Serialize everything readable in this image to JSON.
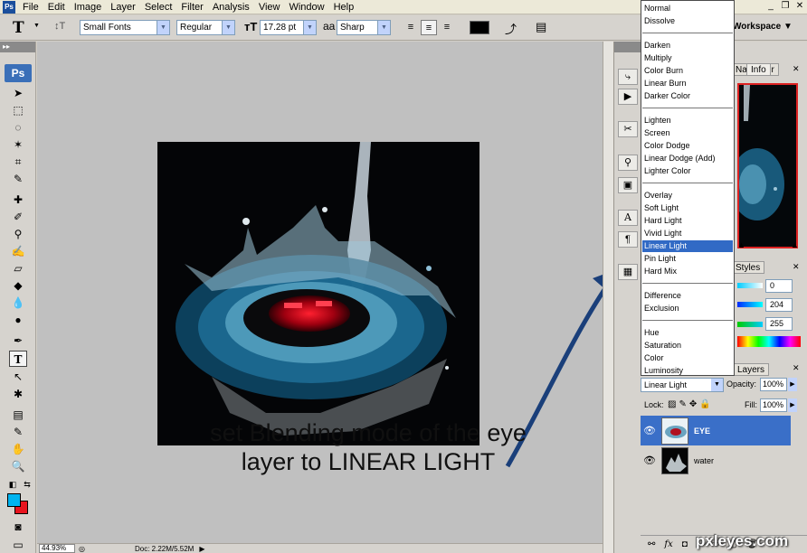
{
  "app": {
    "logo_text": "Ps"
  },
  "menubar": {
    "items": [
      "File",
      "Edit",
      "Image",
      "Layer",
      "Select",
      "Filter",
      "Analysis",
      "View",
      "Window",
      "Help"
    ],
    "workspace_label": "Workspace ▼"
  },
  "options_bar": {
    "tool_glyph": "T",
    "font_family": "Small Fonts",
    "font_style": "Regular",
    "font_size": "17.28 pt",
    "antialias_glyph": "aa",
    "antialias": "Sharp",
    "text_color": "#000000"
  },
  "status_bar": {
    "zoom": "44.93%",
    "doc_info": "Doc: 2.22M/5.52M"
  },
  "panels": {
    "tabs_top": [
      "Navigator",
      "Info"
    ],
    "tab_styles": "Styles",
    "color_values": [
      "0",
      "204",
      "255"
    ],
    "layers_tab": "Layers"
  },
  "layers": {
    "blend_mode": "Linear Light",
    "opacity_label": "Opacity:",
    "opacity": "100%",
    "lock_label": "Lock:",
    "fill_label": "Fill:",
    "fill": "100%",
    "items": [
      {
        "name": "EYE",
        "selected": true
      },
      {
        "name": "water",
        "selected": false
      }
    ],
    "footer_icons": [
      "link-icon",
      "fx-icon",
      "mask-icon",
      "adjustment-icon",
      "folder-icon",
      "new-layer-icon",
      "trash-icon"
    ]
  },
  "blend_modes": {
    "groups": [
      [
        "Normal",
        "Dissolve"
      ],
      [
        "Darken",
        "Multiply",
        "Color Burn",
        "Linear Burn",
        "Darker Color"
      ],
      [
        "Lighten",
        "Screen",
        "Color Dodge",
        "Linear Dodge (Add)",
        "Lighter Color"
      ],
      [
        "Overlay",
        "Soft Light",
        "Hard Light",
        "Vivid Light",
        "Linear Light",
        "Pin Light",
        "Hard Mix"
      ],
      [
        "Difference",
        "Exclusion"
      ],
      [
        "Hue",
        "Saturation",
        "Color",
        "Luminosity"
      ]
    ],
    "selected": "Linear Light"
  },
  "colors": {
    "foreground": "#00b4f0",
    "background": "#e8141e",
    "selection": "#316ac5",
    "arrow": "#1a3f7a"
  },
  "annotation": {
    "line1": "set Blending mode of the eye",
    "line2": "layer to LINEAR LIGHT"
  },
  "watermark": "pxleyes.com"
}
